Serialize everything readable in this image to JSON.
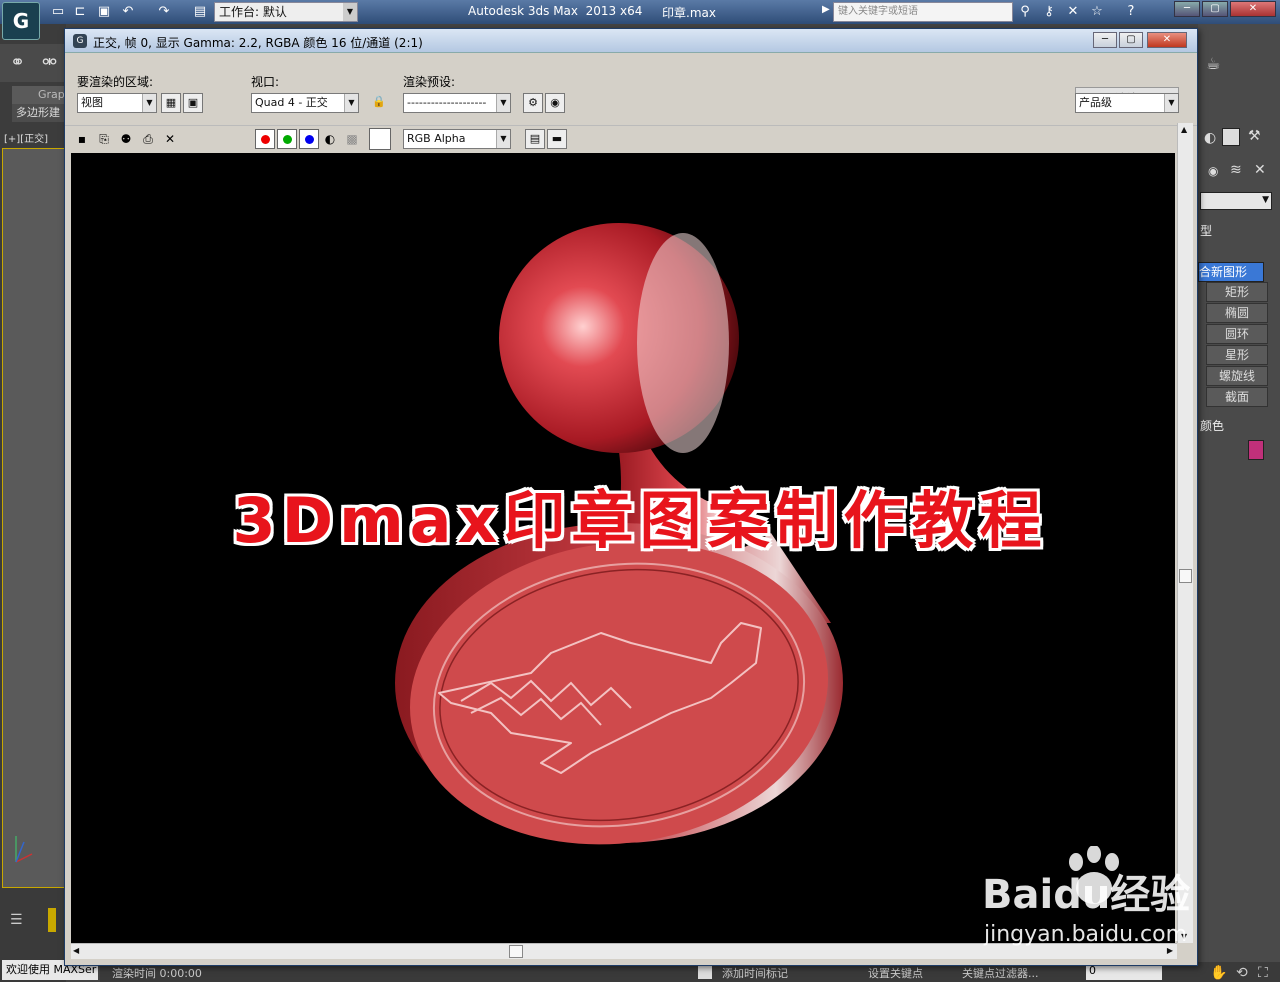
{
  "app": {
    "logo_text": "G",
    "title": "Autodesk 3ds Max  2013 x64",
    "file": "印章.max",
    "workspace_label": "工作台: 默认",
    "search_placeholder": "键入关键字或短语"
  },
  "left_panel": {
    "graphite_label": "Grap",
    "poly_label": "多边形建",
    "viewport_label": "[+][正交]",
    "welcome": "欢迎使用 MAXSer"
  },
  "right_panel": {
    "type_label": "型",
    "items": [
      "合新图形",
      "矩形",
      "椭圆",
      "圆环",
      "星形",
      "螺旋线",
      "截面"
    ],
    "color_label": "颜色",
    "swatch_color": "#c0307a"
  },
  "status_bar": {
    "render_time": "渲染时间  0:00:00",
    "add_marker": "添加时间标记",
    "set_key": "设置关键点",
    "key_filter": "关键点过滤器...",
    "frame_field": "0"
  },
  "render_frame": {
    "title": "正交, 帧 0, 显示 Gamma: 2.2, RGBA 颜色 16 位/通道 (2:1)",
    "area_label": "要渲染的区域:",
    "area_value": "视图",
    "viewport_label": "视口:",
    "viewport_value": "Quad 4 - 正交",
    "preset_label": "渲染预设:",
    "preset_value": "--------------------",
    "render_button": "渲染",
    "quality_value": "产品级",
    "channel_value": "RGB Alpha"
  },
  "overlay": {
    "title": "3Dmax印章图案制作教程",
    "watermark": "Baidu经验",
    "watermark_url": "jingyan.baidu.com"
  },
  "colors": {
    "title_red": "#e8141c",
    "stamp_red": "#cf4a4c"
  }
}
